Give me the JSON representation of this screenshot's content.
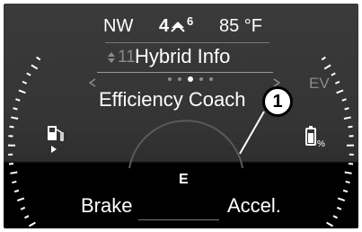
{
  "status_bar": {
    "compass": "NW",
    "gear": "4",
    "gear_sub": "6",
    "temperature": "85 °F"
  },
  "menu": {
    "prev_item": "11",
    "title": "Hybrid Info",
    "page_dots": 5,
    "active_dot_index": 2
  },
  "screen_title": "Efficiency Coach",
  "mode_label": "EV",
  "gauge": {
    "center_icon": "E",
    "left_label": "Brake",
    "right_label": "Accel."
  },
  "callout": {
    "number": "1"
  },
  "icons": {
    "fuel": "fuel-pump-icon",
    "battery": "battery-percent-icon",
    "gear_shift": "shift-up-icon"
  },
  "colors": {
    "screen_bg": "#353535",
    "text": "#ffffff",
    "dim": "#8a8a8a"
  }
}
